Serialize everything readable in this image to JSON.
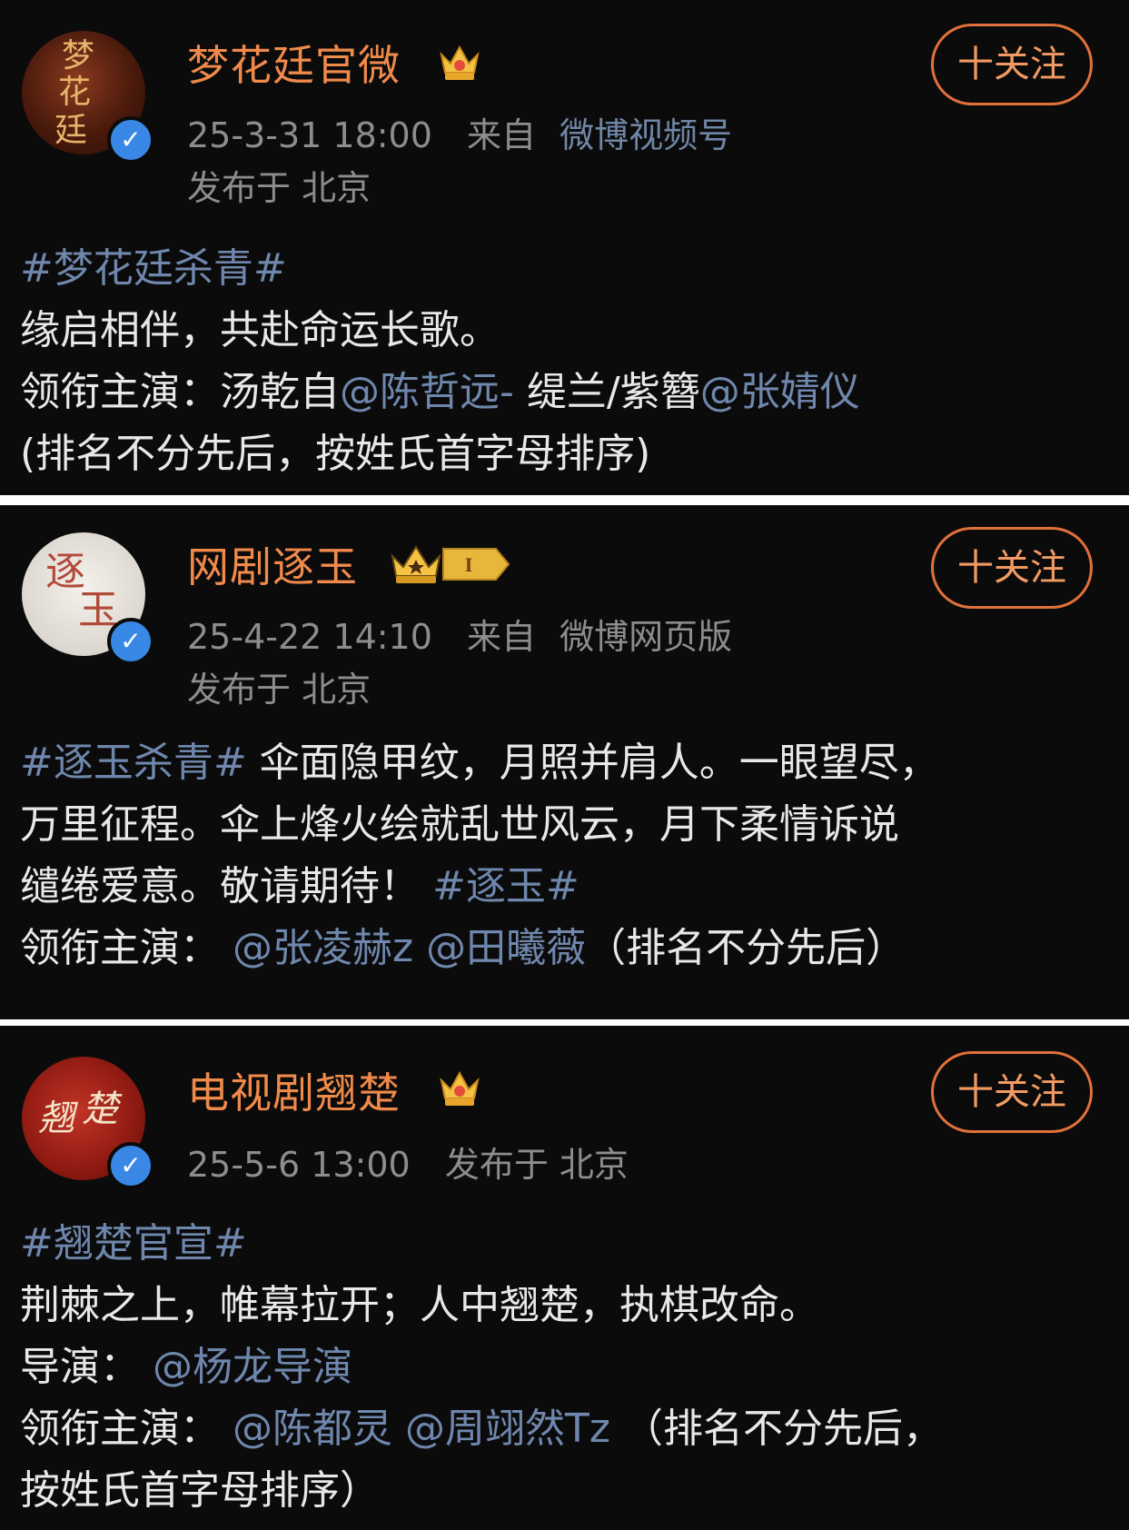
{
  "colors": {
    "background": "#0b0b0b",
    "username": "#f08a4b",
    "link": "#6f87ad",
    "follow_border": "#e0713a",
    "verified": "#3a88e6"
  },
  "follow_label": "十关注",
  "posts": [
    {
      "username": "梦花廷官微",
      "avatar_text": "梦花廷",
      "icons": [
        "verified-icon",
        "crown-badge-icon"
      ],
      "timestamp": "25-3-31 18:00",
      "from_label": "来自",
      "source": "微博视频号",
      "location": "发布于 北京",
      "hashtag": "#梦花廷杀青#",
      "line2": "缘启相伴，共赴命运长歌。",
      "cast_label": "领衔主演：",
      "cast_person1": "汤乾自",
      "cast_mention1": "@陈哲远-",
      "cast_person2": "缇兰/紫簪",
      "cast_mention2": "@张婧仪",
      "note": "(排名不分先后，按姓氏首字母排序)"
    },
    {
      "username": "网剧逐玉",
      "avatar_text": "逐玉",
      "icons": [
        "verified-icon",
        "crown-level-badge-icon"
      ],
      "level_badge": "I",
      "timestamp": "25-4-22 14:10",
      "from_label": "来自",
      "source": "微博网页版",
      "location": "发布于 北京",
      "hashtag1": "#逐玉杀青#",
      "text1": " 伞面隐甲纹，月照并肩人。一眼望尽，",
      "text2": "万里征程。伞上烽火绘就乱世风云，月下柔情诉说",
      "text3": "缱绻爱意。敬请期待！",
      "hashtag2": "#逐玉#",
      "cast_label": "领衔主演：",
      "cast_mention1": "@张凌赫z",
      "cast_mention2": "@田曦薇",
      "note": "（排名不分先后）"
    },
    {
      "username": "电视剧翘楚",
      "avatar_text": "翘楚",
      "icons": [
        "verified-icon",
        "crown-badge-icon"
      ],
      "timestamp": "25-5-6 13:00",
      "location": "发布于 北京",
      "hashtag": "#翘楚官宣#",
      "line2": "荆棘之上，帷幕拉开；人中翘楚，执棋改命。",
      "director_label": "导演：",
      "director_mention": "@杨龙导演",
      "cast_label": "领衔主演：",
      "cast_mention1": "@陈都灵",
      "cast_mention2": "@周翊然Tz",
      "note_part1": "（排名不分先后，",
      "note_part2": "按姓氏首字母排序）"
    }
  ]
}
